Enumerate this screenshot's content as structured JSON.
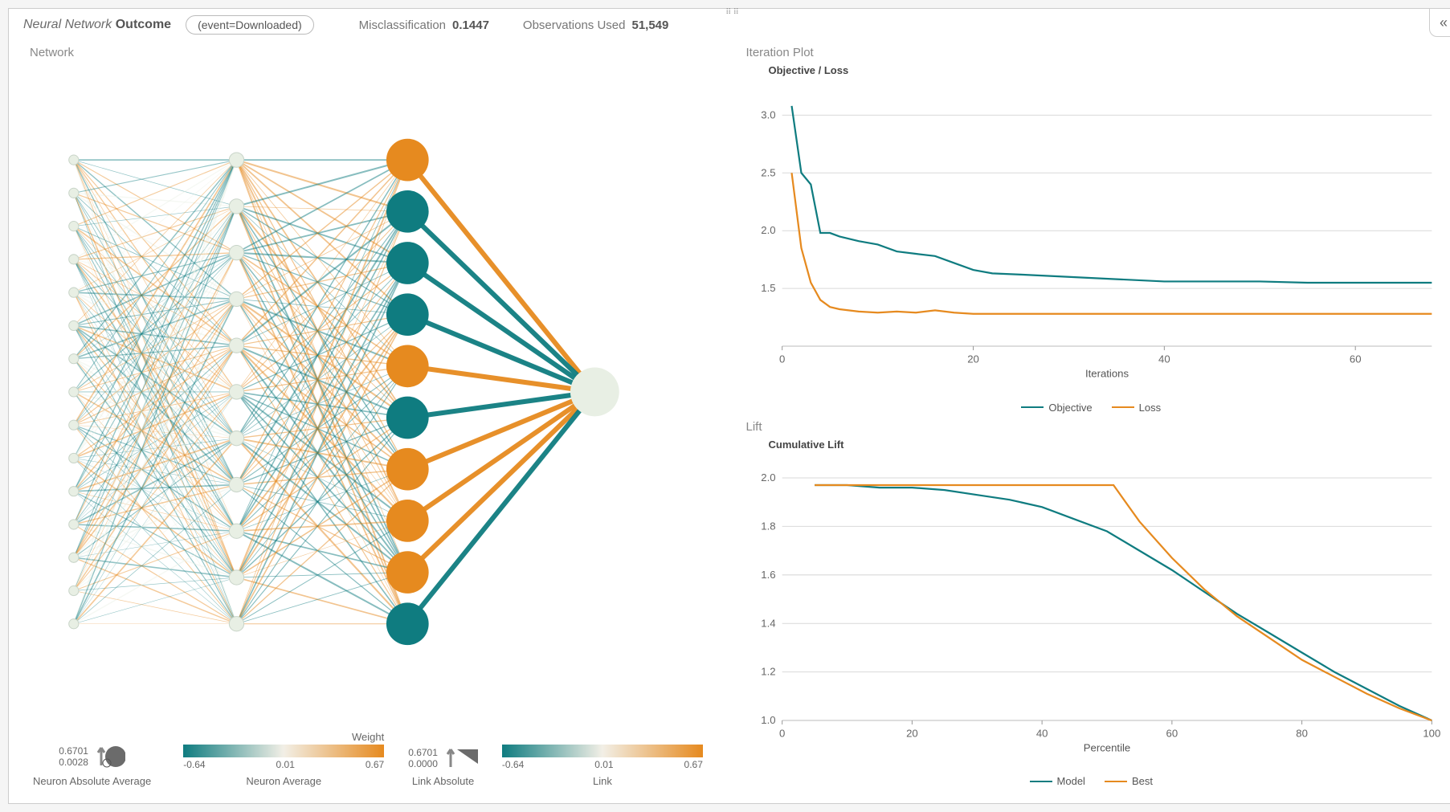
{
  "header": {
    "title_prefix": "Neural Network",
    "title_bold": "Outcome",
    "event_chip": "(event=Downloaded)",
    "misclass_label": "Misclassification",
    "misclass_value": "0.1447",
    "obs_label": "Observations Used",
    "obs_value": "51,549"
  },
  "network": {
    "title": "Network",
    "legend": {
      "neuron_abs_label": "Neuron Absolute Average",
      "neuron_abs_max": "0.6701",
      "neuron_abs_min": "0.0028",
      "weight_label": "Weight",
      "neuron_avg_label": "Neuron Average",
      "neuron_avg_min": "-0.64",
      "neuron_avg_mid": "0.01",
      "neuron_avg_max": "0.67",
      "link_abs_label": "Link Absolute",
      "link_abs_max": "0.6701",
      "link_abs_min": "0.0000",
      "link_label": "Link",
      "link_min": "-0.64",
      "link_mid": "0.01",
      "link_max": "0.67"
    }
  },
  "colors": {
    "teal": "#0f7c80",
    "orange": "#e68a1f",
    "pale": "#e8efe4",
    "grid": "#d9d9d9",
    "axis": "#888"
  },
  "chart_data": [
    {
      "type": "line",
      "title": "Iteration Plot",
      "ytitle": "Objective / Loss",
      "xlabel": "Iterations",
      "ylabel": "",
      "xlim": [
        0,
        68
      ],
      "ylim": [
        1.0,
        3.1
      ],
      "xticks": [
        0,
        20,
        40,
        60
      ],
      "yticks": [
        1.5,
        2.0,
        2.5,
        3.0
      ],
      "series": [
        {
          "name": "Objective",
          "color": "#0f7c80",
          "x": [
            1,
            2,
            3,
            4,
            5,
            6,
            8,
            10,
            12,
            14,
            16,
            18,
            20,
            22,
            25,
            30,
            35,
            40,
            45,
            50,
            55,
            60,
            65,
            68
          ],
          "y": [
            3.08,
            2.5,
            2.4,
            1.98,
            1.98,
            1.95,
            1.91,
            1.88,
            1.82,
            1.8,
            1.78,
            1.72,
            1.66,
            1.63,
            1.62,
            1.6,
            1.58,
            1.56,
            1.56,
            1.56,
            1.55,
            1.55,
            1.55,
            1.55
          ]
        },
        {
          "name": "Loss",
          "color": "#e68a1f",
          "x": [
            1,
            2,
            3,
            4,
            5,
            6,
            8,
            10,
            12,
            14,
            16,
            18,
            20,
            25,
            30,
            35,
            40,
            45,
            50,
            55,
            60,
            65,
            68
          ],
          "y": [
            2.5,
            1.85,
            1.55,
            1.4,
            1.34,
            1.32,
            1.3,
            1.29,
            1.3,
            1.29,
            1.31,
            1.29,
            1.28,
            1.28,
            1.28,
            1.28,
            1.28,
            1.28,
            1.28,
            1.28,
            1.28,
            1.28,
            1.28
          ]
        }
      ]
    },
    {
      "type": "line",
      "title": "Lift",
      "ytitle": "Cumulative Lift",
      "xlabel": "Percentile",
      "ylabel": "",
      "xlim": [
        0,
        100
      ],
      "ylim": [
        1.0,
        2.0
      ],
      "xticks": [
        0,
        20,
        40,
        60,
        80,
        100
      ],
      "yticks": [
        1.0,
        1.2,
        1.4,
        1.6,
        1.8,
        2.0
      ],
      "series": [
        {
          "name": "Model",
          "color": "#0f7c80",
          "x": [
            5,
            10,
            15,
            20,
            25,
            30,
            35,
            40,
            45,
            50,
            55,
            60,
            65,
            70,
            75,
            80,
            85,
            90,
            95,
            100
          ],
          "y": [
            1.97,
            1.97,
            1.96,
            1.96,
            1.95,
            1.93,
            1.91,
            1.88,
            1.83,
            1.78,
            1.7,
            1.62,
            1.53,
            1.44,
            1.36,
            1.28,
            1.2,
            1.13,
            1.06,
            1.0
          ]
        },
        {
          "name": "Best",
          "color": "#e68a1f",
          "x": [
            5,
            10,
            15,
            20,
            25,
            30,
            35,
            40,
            45,
            50,
            51,
            55,
            60,
            65,
            70,
            75,
            80,
            85,
            90,
            95,
            100
          ],
          "y": [
            1.97,
            1.97,
            1.97,
            1.97,
            1.97,
            1.97,
            1.97,
            1.97,
            1.97,
            1.97,
            1.97,
            1.82,
            1.67,
            1.54,
            1.43,
            1.34,
            1.25,
            1.18,
            1.11,
            1.05,
            1.0
          ]
        }
      ]
    }
  ]
}
